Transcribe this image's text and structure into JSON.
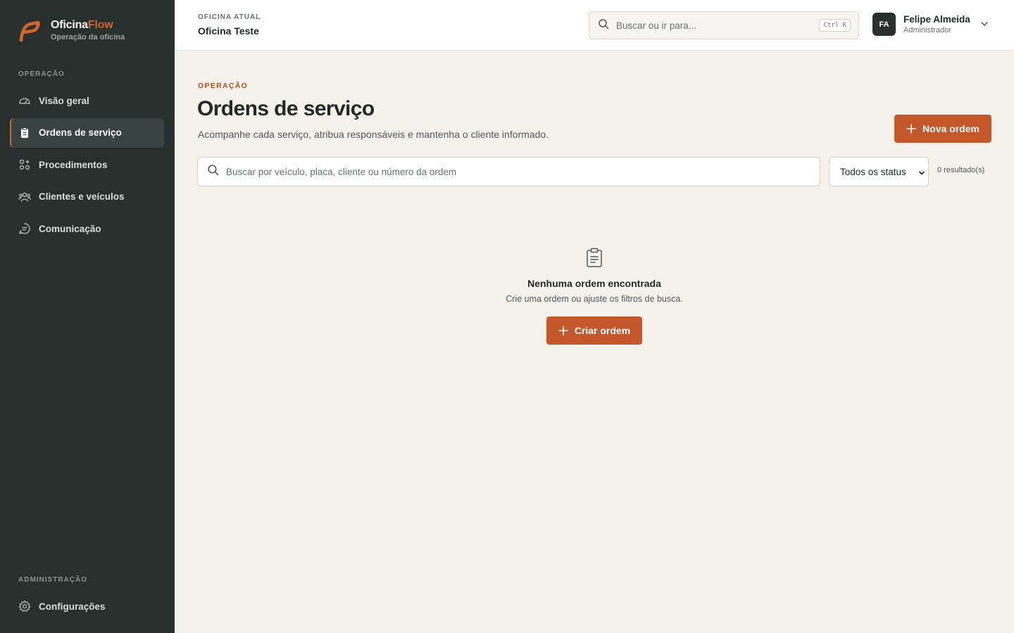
{
  "brand": {
    "name_main": "Oficina",
    "name_accent": "Flow",
    "subtitle": "Operação da oficina",
    "logo": "oficinaflow-logo",
    "accent_color": "#d2642c"
  },
  "sidebar": {
    "section_operation": "OPERAÇÃO",
    "items": [
      {
        "label": "Visão geral",
        "icon": "gauge-icon",
        "active": false
      },
      {
        "label": "Ordens de serviço",
        "icon": "clipboard-icon",
        "active": true
      },
      {
        "label": "Procedimentos",
        "icon": "procedures-icon",
        "active": false
      },
      {
        "label": "Clientes e veículos",
        "icon": "users-icon",
        "active": false
      },
      {
        "label": "Comunicação",
        "icon": "message-icon",
        "active": false
      }
    ],
    "section_admin": "ADMINISTRAÇÃO",
    "admin_items": [
      {
        "label": "Configurações",
        "icon": "gear-icon"
      }
    ]
  },
  "topbar": {
    "shop_label": "OFICINA ATUAL",
    "shop_name": "Oficina Teste",
    "search_placeholder": "Buscar ou ir para...",
    "search_shortcut": "Ctrl K",
    "user": {
      "initials": "FA",
      "name": "Felipe Almeida",
      "role": "Administrador"
    }
  },
  "main": {
    "eyebrow": "OPERAÇÃO",
    "title": "Ordens de serviço",
    "description": "Acompanhe cada serviço, atribua responsáveis e mantenha o cliente informado.",
    "new_button": "Nova ordem",
    "filter_placeholder": "Buscar por veículo, placa, cliente ou número da ordem",
    "status_filter": "Todos os status",
    "results_count": "0 resultado(s)",
    "empty": {
      "title": "Nenhuma ordem encontrada",
      "description": "Crie uma ordem ou ajuste os filtros de busca.",
      "button": "Criar ordem"
    }
  },
  "colors": {
    "sidebar_bg": "#28302d",
    "primary": "#c4582a",
    "page_bg": "#f5f2ec"
  }
}
